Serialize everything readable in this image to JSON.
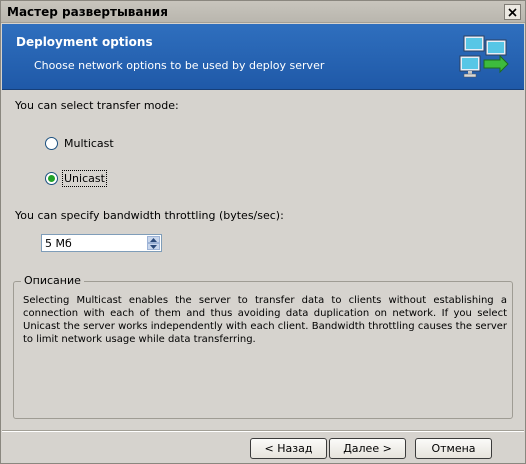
{
  "window": {
    "title": "Мастер развертывания",
    "close_icon": "close-icon"
  },
  "banner": {
    "title": "Deployment options",
    "subtitle": "Choose network options to be used by deploy server",
    "icon": "network-computers-icon"
  },
  "transfer": {
    "label": "You can select transfer mode:",
    "options": [
      {
        "label": "Multicast",
        "selected": false
      },
      {
        "label": "Unicast",
        "selected": true
      }
    ]
  },
  "bandwidth": {
    "label": "You can specify bandwidth throttling (bytes/sec):",
    "value": "5 Мб"
  },
  "description": {
    "title": "Описание",
    "text": "Selecting Multicast enables the server to transfer data to clients without establishing a connection with each of them and thus avoiding data duplication on network. If you select Unicast the server works independently with each client. Bandwidth throttling causes the server to limit network usage while data transferring."
  },
  "buttons": {
    "back": "< Назад",
    "next": "Далее >",
    "cancel": "Отмена"
  },
  "colors": {
    "banner": "#2f6fbe",
    "radio_selected": "#22a32a"
  }
}
